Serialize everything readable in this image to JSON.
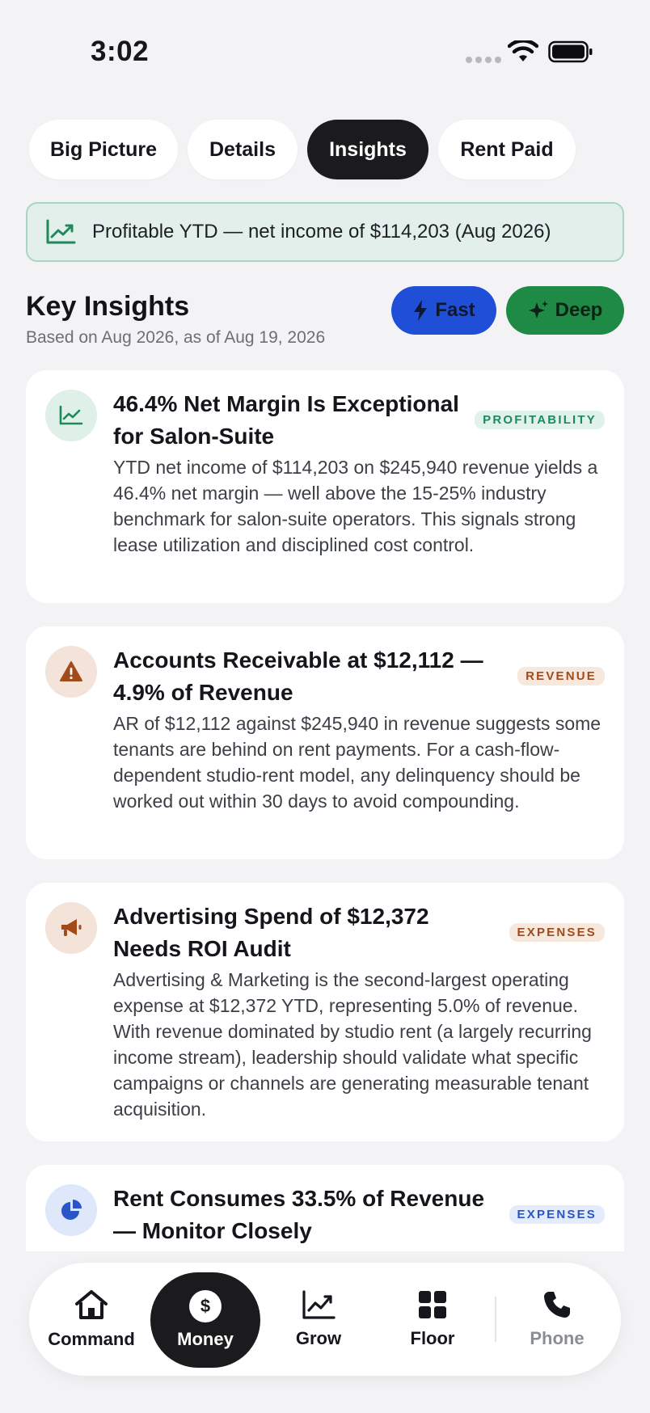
{
  "status_bar": {
    "time": "3:02"
  },
  "tabs": [
    {
      "label": "Big Picture",
      "active": false
    },
    {
      "label": "Details",
      "active": false
    },
    {
      "label": "Insights",
      "active": true
    },
    {
      "label": "Rent Paid",
      "active": false
    }
  ],
  "banner": {
    "text": "Profitable YTD — net income of $114,203 (Aug 2026)",
    "icon": "trend-up-icon"
  },
  "section": {
    "title": "Key Insights",
    "subtitle": "Based on Aug 2026, as of Aug 19, 2026",
    "fast_label": "Fast",
    "deep_label": "Deep"
  },
  "cards": [
    {
      "icon": "chart-line-icon",
      "title": "46.4% Net Margin Is Exceptional for Salon-Suite",
      "badge": "PROFITABILITY",
      "badge_color": "#1e8a5b",
      "body": "YTD net income of $114,203 on $245,940 revenue yields a 46.4% net margin — well above the 15-25% industry benchmark for salon-suite operators. This signals strong lease utilization and disciplined cost control."
    },
    {
      "icon": "warning-icon",
      "title": "Accounts Receivable at $12,112 — 4.9% of Revenue",
      "badge": "REVENUE",
      "badge_color": "#a34a1a",
      "body": "AR of $12,112 against $245,940 in revenue suggests some tenants are behind on rent payments. For a cash-flow-dependent studio-rent model, any delinquency should be worked out within 30 days to avoid compounding."
    },
    {
      "icon": "megaphone-icon",
      "title": "Advertising Spend of $12,372 Needs ROI Audit",
      "badge": "EXPENSES",
      "badge_color": "#a34a1a",
      "body": "Advertising & Marketing is the second-largest operating expense at $12,372 YTD, representing 5.0% of revenue. With revenue dominated by studio rent (a largely recurring income stream), leadership should validate what specific campaigns or channels are generating measurable tenant acquisition."
    },
    {
      "icon": "pie-chart-icon",
      "title": "Rent Consumes 33.5% of Revenue — Monitor Closely",
      "badge": "EXPENSES",
      "badge_color": "#2a55c9",
      "body": ""
    }
  ],
  "nav": {
    "items": [
      {
        "label": "Command",
        "icon": "home-icon"
      },
      {
        "label": "Money",
        "icon": "dollar-icon",
        "active": true
      },
      {
        "label": "Grow",
        "icon": "chart-line-icon"
      },
      {
        "label": "Floor",
        "icon": "grid-icon"
      },
      {
        "label": "Phone",
        "icon": "phone-icon"
      }
    ]
  }
}
